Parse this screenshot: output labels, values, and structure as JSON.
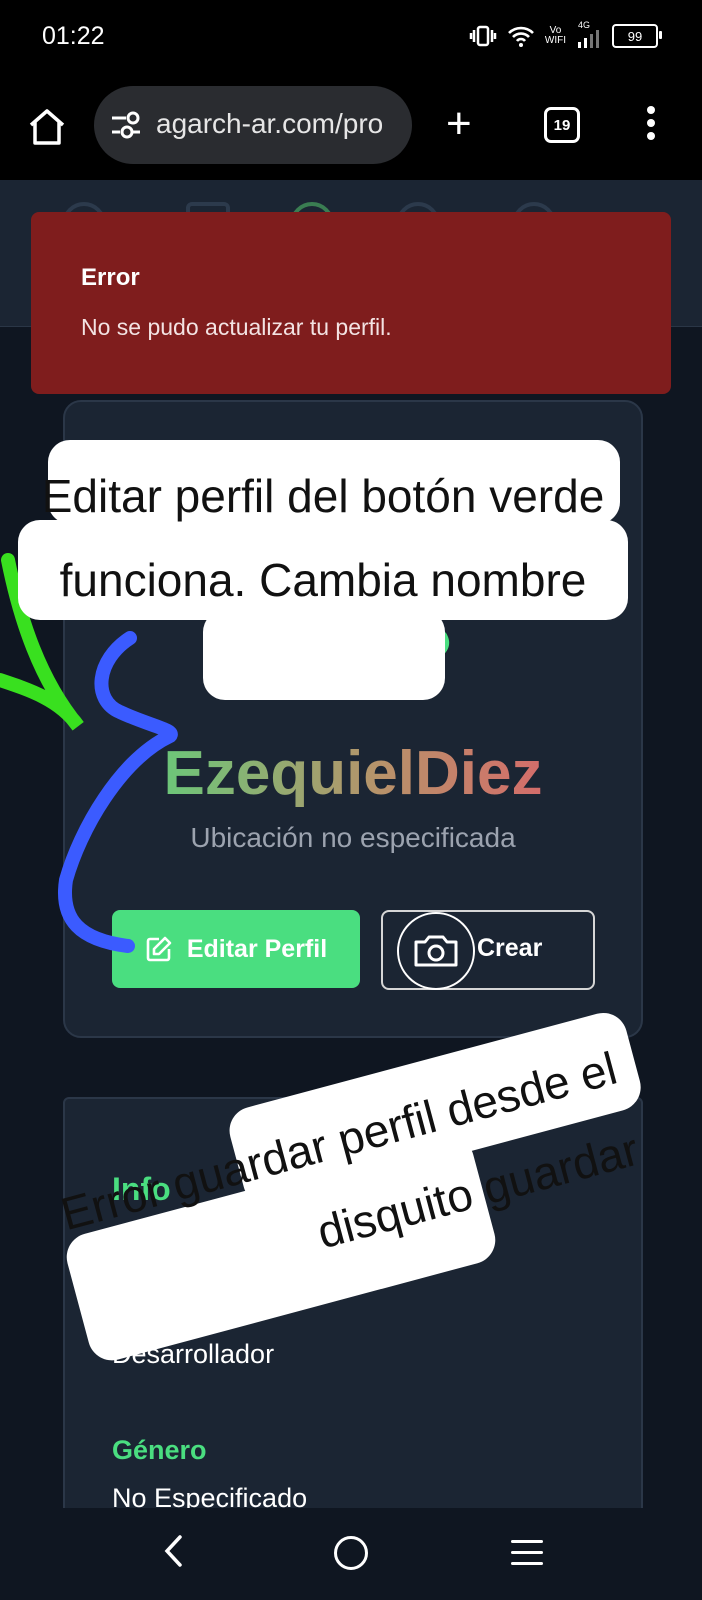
{
  "status_bar": {
    "time": "01:22",
    "network": "4G",
    "vowifi_top": "Vo",
    "vowifi_bottom": "WIFI",
    "battery": "99"
  },
  "browser": {
    "url": "agarch-ar.com/pro",
    "tab_count": "19"
  },
  "toast": {
    "title": "Error",
    "message": "No se pudo actualizar tu perfil."
  },
  "profile": {
    "username": "EzequielDiez",
    "location": "Ubicación no especificada",
    "edit_button": "Editar Perfil",
    "create_button": "Crear"
  },
  "info": {
    "section_title": "Info",
    "role": "Desarrollador",
    "gender_label": "Género",
    "gender_value": "No Especificado"
  },
  "annotations": {
    "note1": "Editar perfil del botón verde funciona. Cambia nombre",
    "note2": "Error guardar perfil desde el disquito guardar",
    "colors": {
      "green": "#4ade80",
      "blue": "#3b5bff",
      "error": "#7f1d1d"
    }
  }
}
